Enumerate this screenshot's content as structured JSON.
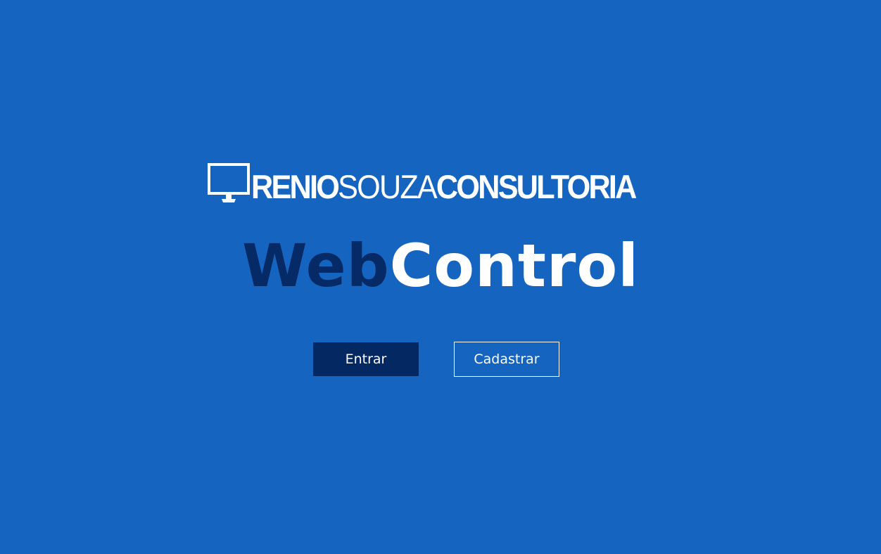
{
  "logo": {
    "part1": "RENIO",
    "part2": "SOUZA",
    "part3": "CONSULTORIA",
    "icon": "monitor-icon"
  },
  "title": {
    "part1": "Web",
    "part2": "Control"
  },
  "actions": {
    "login_label": "Entrar",
    "register_label": "Cadastrar"
  },
  "colors": {
    "background": "#1565c0",
    "accent_dark": "#062a66",
    "text": "#ffffff"
  }
}
